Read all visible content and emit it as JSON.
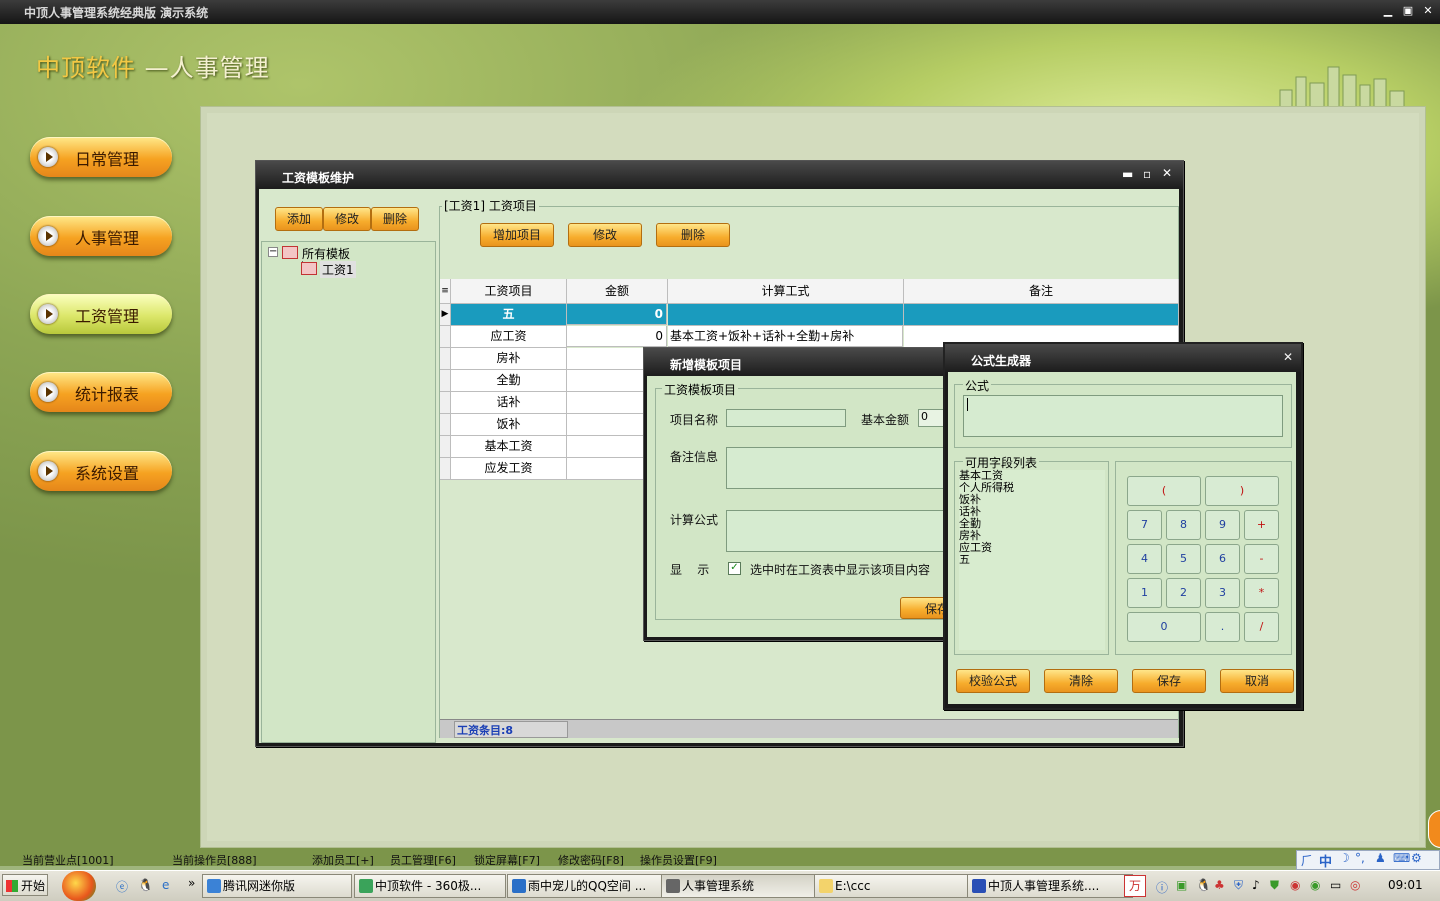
{
  "window": {
    "title": "中顶人事管理系统经典版 演示系统",
    "min": "▁",
    "max": "▣",
    "close": "✕"
  },
  "app": {
    "brand": "中顶软件",
    "subtitle": " —人事管理"
  },
  "nav": [
    {
      "label": "日常管理"
    },
    {
      "label": "人事管理"
    },
    {
      "label": "工资管理"
    },
    {
      "label": "统计报表"
    },
    {
      "label": "系统设置"
    }
  ],
  "salary_window": {
    "title": "工资模板维护",
    "buttons": {
      "add": "添加",
      "edit": "修改",
      "delete": "删除"
    },
    "tree": {
      "root": "所有模板",
      "child": "工资1"
    },
    "section_title": "[工资1] 工资项目",
    "item_buttons": {
      "add": "增加项目",
      "edit": "修改",
      "delete": "删除"
    },
    "grid": {
      "columns": [
        "工资项目",
        "金额",
        "计算工式",
        "备注"
      ],
      "rows": [
        {
          "name": "五",
          "amount": "0",
          "formula": "",
          "note": ""
        },
        {
          "name": "应工资",
          "amount": "0",
          "formula": "基本工资+饭补+话补+全勤+房补",
          "note": ""
        },
        {
          "name": "房补",
          "amount": "",
          "formula": "",
          "note": ""
        },
        {
          "name": "全勤",
          "amount": "",
          "formula": "",
          "note": ""
        },
        {
          "name": "话补",
          "amount": "",
          "formula": "",
          "note": ""
        },
        {
          "name": "饭补",
          "amount": "",
          "formula": "",
          "note": ""
        },
        {
          "name": "基本工资",
          "amount": "",
          "formula": "",
          "note": ""
        },
        {
          "name": "应发工资",
          "amount": "",
          "formula": "",
          "note": ""
        }
      ]
    },
    "status": "工资条目:8"
  },
  "new_item_window": {
    "title": "新增模板项目",
    "group": "工资模板项目",
    "name_label": "项目名称",
    "amount_label": "基本金额",
    "amount_value": "0",
    "note_label": "备注信息",
    "formula_label": "计算公式",
    "show_label": "显    示",
    "show_check": "选中时在工资表中显示该项目内容",
    "save": "保存"
  },
  "formula_window": {
    "title": "公式生成器",
    "formula_group": "公式",
    "fields_group": "可用字段列表",
    "fields": [
      "基本工资",
      "个人所得税",
      "饭补",
      "话补",
      "全勤",
      "房补",
      "应工资",
      "五"
    ],
    "keys": [
      [
        "(",
        ")"
      ],
      [
        "7",
        "8",
        "9",
        "+"
      ],
      [
        "4",
        "5",
        "6",
        "-"
      ],
      [
        "1",
        "2",
        "3",
        "*"
      ],
      [
        "0",
        ".",
        "/"
      ]
    ],
    "buttons": {
      "check": "校验公式",
      "clear": "清除",
      "save": "保存",
      "cancel": "取消"
    }
  },
  "statusbar": {
    "site": "当前营业点[1001]",
    "operator": "当前操作员[888]",
    "shortcuts": [
      "添加员工[+]",
      "员工管理[F6]",
      "锁定屏幕[F7]",
      "修改密码[F8]",
      "操作员设置[F9]"
    ]
  },
  "taskbar": {
    "start": "开始",
    "tasks": [
      "腾讯网迷你版",
      "中顶软件 - 360极...",
      "雨中宠儿的QQ空间 ...",
      "人事管理系统",
      "E:\\ccc",
      "中顶人事管理系统...."
    ],
    "clock": "09:01",
    "ime": "中"
  },
  "colors": {
    "selected_row": "#1a9bbe",
    "orange": "#f7ad2d",
    "panel": "#d2e6c6"
  }
}
